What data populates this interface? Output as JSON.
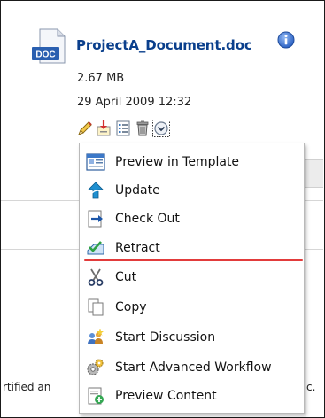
{
  "document": {
    "name": "ProjectA_Document.doc",
    "size": "2.67 MB",
    "modified": "29 April 2009 12:32",
    "type_badge": "DOC"
  },
  "actions": [
    {
      "name": "edit-icon"
    },
    {
      "name": "download-icon"
    },
    {
      "name": "properties-icon"
    },
    {
      "name": "delete-icon"
    },
    {
      "name": "more-actions-icon"
    }
  ],
  "menu": {
    "items": [
      {
        "label": "Preview in Template",
        "icon": "preview-template-icon"
      },
      {
        "label": "Update",
        "icon": "update-icon"
      },
      {
        "label": "Check Out",
        "icon": "check-out-icon"
      },
      {
        "label": "Retract",
        "icon": "retract-icon"
      },
      {
        "label": "Cut",
        "icon": "cut-icon"
      },
      {
        "label": "Copy",
        "icon": "copy-icon"
      },
      {
        "label": "Start Discussion",
        "icon": "discussion-icon"
      },
      {
        "label": "Start Advanced Workflow",
        "icon": "workflow-icon"
      },
      {
        "label": "Preview Content",
        "icon": "preview-content-icon"
      }
    ]
  },
  "background": {
    "left_fragment": "rtified an",
    "right_fragment": "c."
  },
  "colors": {
    "title": "#0a3f8c",
    "highlight_underline": "#e23b3b"
  }
}
